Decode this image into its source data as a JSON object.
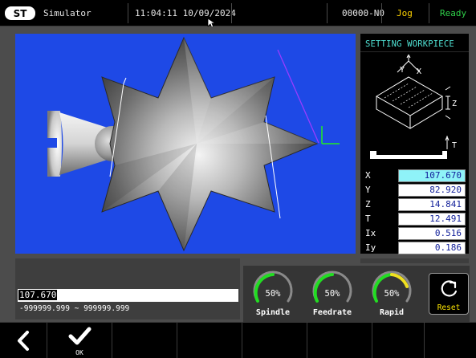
{
  "topbar": {
    "logo_icon": "st-logo",
    "mode_title": "Simulator",
    "datetime": "11:04:11 10/09/2024",
    "program": "00000-N0",
    "mode": "Jog",
    "status": "Ready",
    "mode_color": "#ffd400",
    "status_color": "#2fd14a"
  },
  "sidebar": {
    "title": "SETTING WORKPIECE",
    "diagram": {
      "axis_y": "Y",
      "axis_x": "X",
      "axis_z": "Z",
      "axis_t": "T"
    },
    "values": [
      {
        "label": "X",
        "value": "107.670",
        "active": true
      },
      {
        "label": "Y",
        "value": "82.920",
        "active": false
      },
      {
        "label": "Z",
        "value": "14.841",
        "active": false
      },
      {
        "label": "T",
        "value": "12.491",
        "active": false
      },
      {
        "label": "Ix",
        "value": "0.516",
        "active": false
      },
      {
        "label": "Iy",
        "value": "0.186",
        "active": false
      }
    ]
  },
  "input": {
    "value": "107.670",
    "range": "-999999.999 ~ 999999.999"
  },
  "gauges": [
    {
      "label": "Spindle",
      "value": "50%",
      "fraction": 0.5,
      "color": "#22dd22"
    },
    {
      "label": "Feedrate",
      "value": "50%",
      "fraction": 0.5,
      "color": "#22dd22"
    },
    {
      "label": "Rapid",
      "value": "50%",
      "fraction": 0.5,
      "color": "#f0e020"
    }
  ],
  "reset": {
    "label": "Reset",
    "icon": "reset-icon"
  },
  "bottombar": {
    "back_icon": "chevron-left-icon",
    "ok_icon": "checkmark-icon",
    "ok_label": "OK"
  },
  "colors": {
    "viewport_bg": "#1e49e6",
    "title_accent": "#4fe0d2",
    "active_field": "#8ff3f8"
  }
}
